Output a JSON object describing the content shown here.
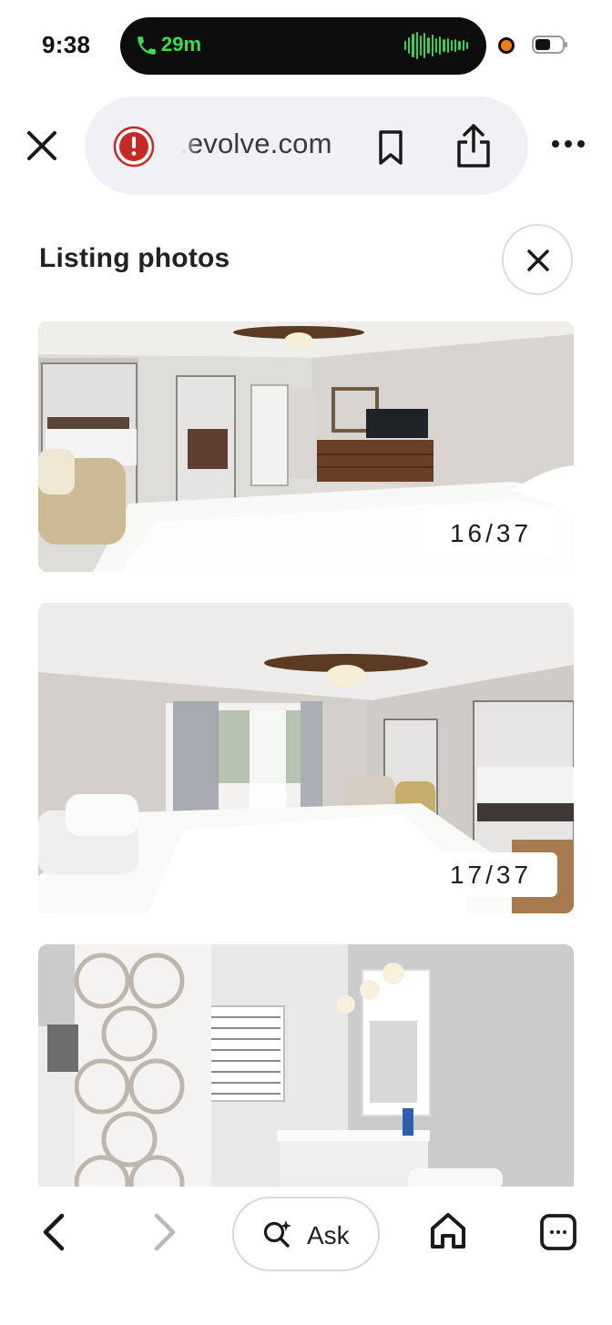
{
  "status_bar": {
    "time": "9:38",
    "call_duration": "29m",
    "call_color": "#3ddc4e",
    "recording_indicator_color": "#f07e1c",
    "icons": [
      "phone-icon",
      "audio-waveform-icon",
      "recording-dot-icon",
      "battery-icon"
    ]
  },
  "browser": {
    "url": "evolve.com",
    "url_prefix_visible": ".",
    "security_icon": "warning-icon",
    "security_icon_color": "#c62828",
    "actions": [
      "bookmark-icon",
      "share-icon",
      "more-icon"
    ],
    "close_icon": "close-icon"
  },
  "header": {
    "title": "Listing photos",
    "close_icon": "close-icon"
  },
  "photos": [
    {
      "counter": "16/37",
      "scene": "bedroom with ceiling fan, mirrored closet doors and dresser with TV"
    },
    {
      "counter": "17/37",
      "scene": "bedroom with ceiling fan, curtained window, armchair and mirrored closet"
    },
    {
      "counter": "",
      "scene": "bathroom with patterned shower curtain, vanity and mirror"
    }
  ],
  "toolbar": {
    "back_icon": "chevron-left-icon",
    "forward_icon": "chevron-right-icon",
    "ask_label": "Ask",
    "ask_icon": "ai-search-icon",
    "home_icon": "home-icon",
    "tabs_icon": "tabs-icon"
  }
}
